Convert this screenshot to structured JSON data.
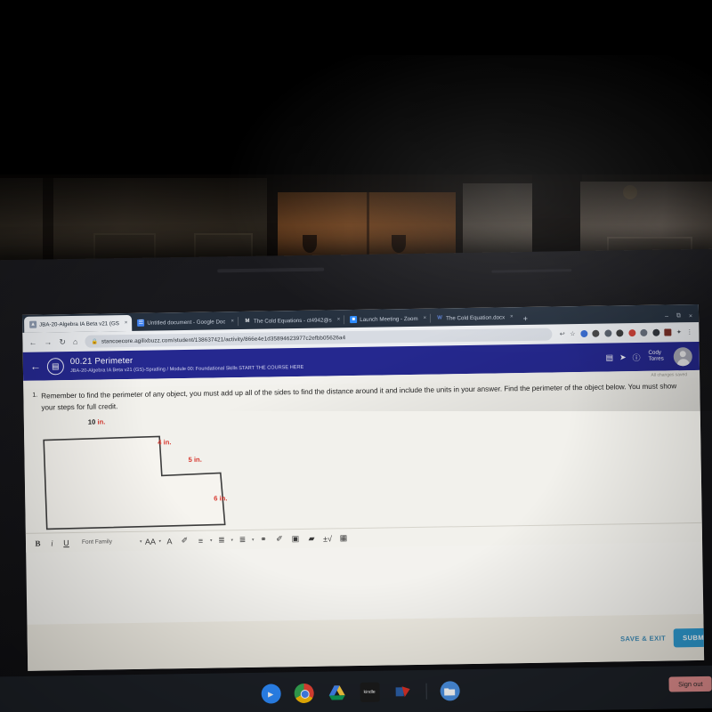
{
  "browser": {
    "tabs": [
      {
        "title": "JBA-20-Algebra IA Beta v21 (GS",
        "favicon": "agilix-icon",
        "active": true,
        "close": "×"
      },
      {
        "title": "Untitled document - Google Doc",
        "favicon": "google-docs-icon",
        "active": false,
        "close": "×"
      },
      {
        "title": "The Cold Equations - ct4942@s",
        "favicon": "gmail-icon",
        "active": false,
        "close": "×"
      },
      {
        "title": "Launch Meeting - Zoom",
        "favicon": "zoom-icon",
        "active": false,
        "close": "×"
      },
      {
        "title": "The Cold Equation.docx",
        "favicon": "word-icon",
        "active": false,
        "close": "×"
      }
    ],
    "new_tab_label": "+",
    "window_controls": {
      "minimize": "–",
      "maximize": "⧉",
      "close": "×"
    },
    "nav": {
      "back": "←",
      "forward": "→",
      "reload": "↻",
      "home": "⌂"
    },
    "url": "stancoecore.agilixbuzz.com/student/138637421/activity/866e4e1d35894623977c2efbb05626a4",
    "lock_icon": "🔒",
    "omnibox_right": {
      "share": "↩",
      "bookmark": "☆",
      "menu": "⋮"
    }
  },
  "app_header": {
    "back_arrow": "←",
    "activity_title": "00.21 Perimeter",
    "breadcrumb": "JBA-20-Algebra IA Beta v21 (GS)-Spratling / Module 00: Foundational Skills START THE COURSE HERE",
    "calculator_icon": "▤",
    "send_icon": "➤",
    "help_icon": "?",
    "user_name_line1": "Cody",
    "user_name_line2": "Torres",
    "accent_color": "#25288f"
  },
  "status": {
    "saved_text": "All changes saved"
  },
  "question": {
    "number": "1.",
    "text": "Remember to find the perimeter of any object, you must add up all of the sides to find the distance around it and include the units in your answer. Find the perimeter of the object below. You must show your steps for full credit."
  },
  "figure": {
    "label_color": "#d7352c",
    "labels": [
      {
        "value": "10",
        "unit": "in."
      },
      {
        "value": "4",
        "unit": "in."
      },
      {
        "value": "5",
        "unit": "in."
      },
      {
        "value": "6",
        "unit": "in."
      }
    ]
  },
  "editor_toolbar": {
    "bold": "B",
    "italic": "i",
    "underline": "U",
    "font_family_label": "Font Family",
    "font_size": "AA",
    "text_color": "A",
    "highlighter": "✐",
    "align": "≡",
    "numbered_list": "≣",
    "bullet_list": "≣",
    "link": "⚭",
    "draw": "✐",
    "image": "▣",
    "video": "▰",
    "math": "±√",
    "table": "▦",
    "caret": "▾"
  },
  "footer": {
    "save_exit_label": "SAVE & EXIT",
    "submit_label": "SUBMIT A",
    "submit_color": "#2e9ad0"
  },
  "shelf": {
    "icons": [
      {
        "name": "zoom-app-icon",
        "glyph": "■"
      },
      {
        "name": "chrome-app-icon",
        "glyph": ""
      },
      {
        "name": "google-drive-app-icon",
        "glyph": "▲"
      },
      {
        "name": "kindle-app-icon",
        "glyph": "kindle"
      },
      {
        "name": "app-icon",
        "glyph": "✉"
      },
      {
        "name": "files-app-icon",
        "glyph": "▭"
      }
    ],
    "sign_out_label": "Sign out"
  }
}
